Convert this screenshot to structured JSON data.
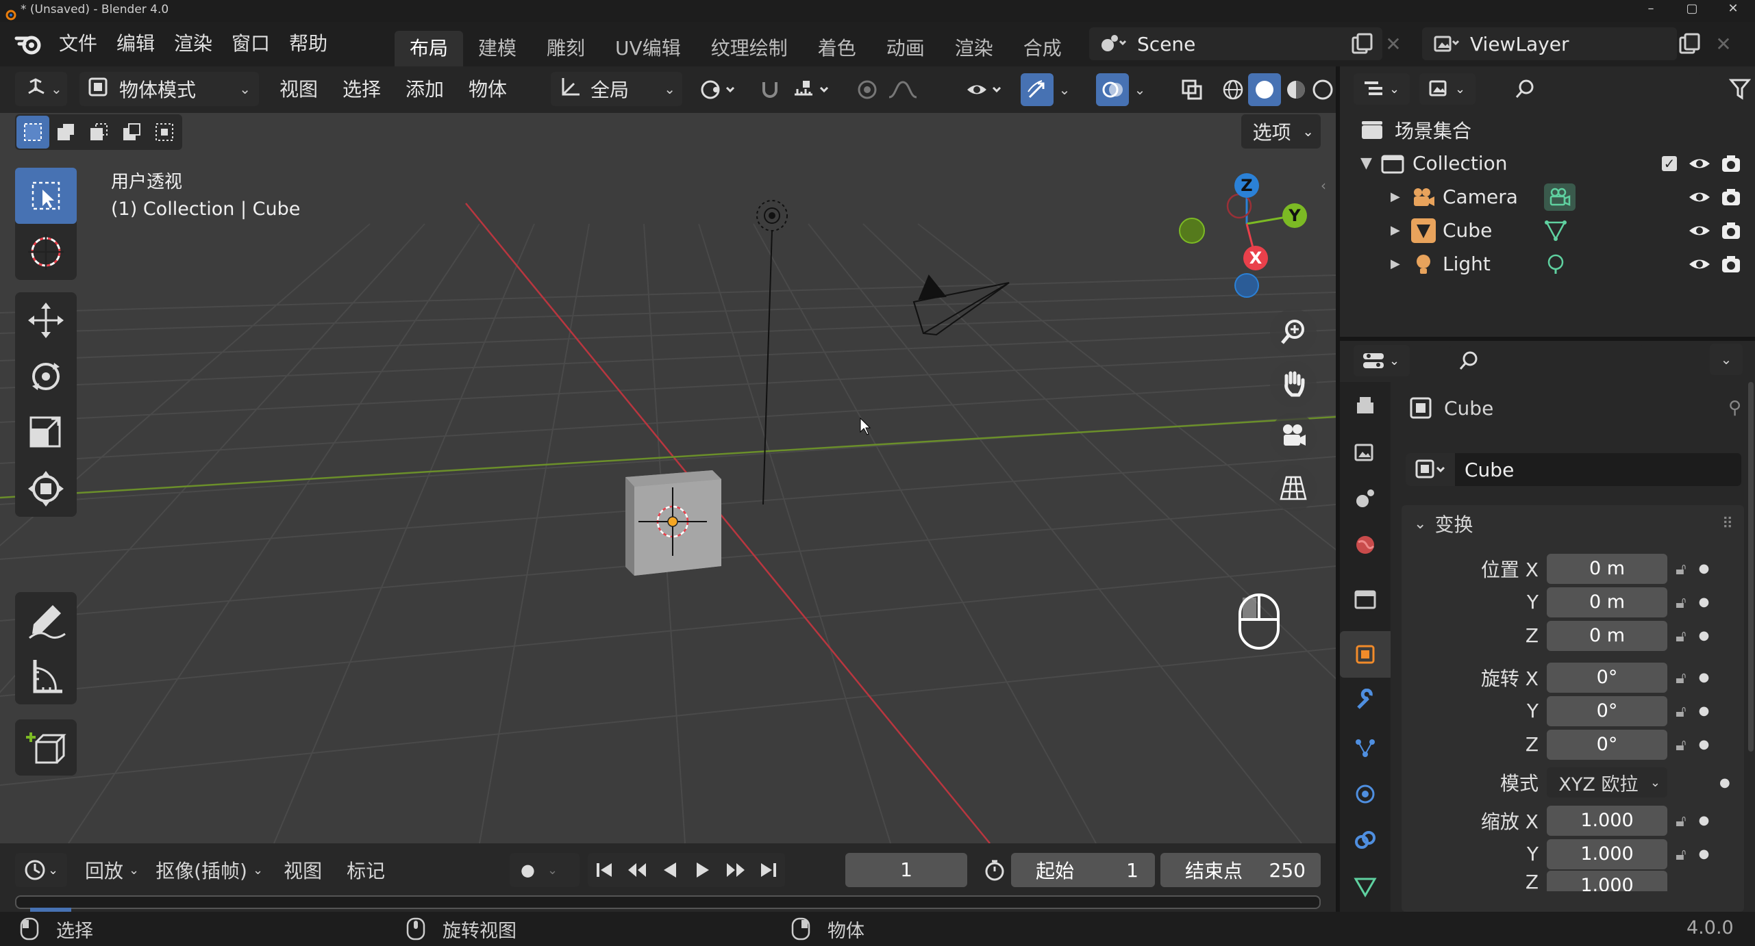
{
  "window": {
    "title": "* (Unsaved) - Blender 4.0",
    "controls": [
      "–",
      "▢",
      "✕"
    ]
  },
  "topbar": {
    "menus": [
      "文件",
      "编辑",
      "渲染",
      "窗口",
      "帮助"
    ],
    "workspaces": [
      "布局",
      "建模",
      "雕刻",
      "UV编辑",
      "纹理绘制",
      "着色",
      "动画",
      "渲染",
      "合成"
    ],
    "active_workspace": "布局",
    "scene_name": "Scene",
    "view_layer": "ViewLayer"
  },
  "viewport": {
    "mode": "物体模式",
    "menus": [
      "视图",
      "选择",
      "添加",
      "物体"
    ],
    "orientation": "全局",
    "options_label": "选项",
    "view_name": "用户透视",
    "context": "(1) Collection | Cube",
    "axes": {
      "x": "X",
      "y": "Y",
      "z": "Z"
    },
    "tools": [
      "select-box-tool",
      "cursor-tool",
      "move-tool",
      "rotate-tool",
      "scale-tool",
      "transform-tool",
      "annotate-tool",
      "measure-tool",
      "add-cube-tool"
    ],
    "colors": {
      "x_axis": "#e9404b",
      "y_axis": "#7cba24",
      "z_axis": "#2b81d7",
      "active_tool": "#4772b3",
      "selection": "#f5a623"
    }
  },
  "outliner": {
    "root": "场景集合",
    "collection": "Collection",
    "items": [
      {
        "name": "Camera",
        "type": "camera"
      },
      {
        "name": "Cube",
        "type": "mesh"
      },
      {
        "name": "Light",
        "type": "light"
      }
    ]
  },
  "properties": {
    "object_name": "Cube",
    "datablock_name": "Cube",
    "panel_title": "变换",
    "location": {
      "label": "位置 X",
      "y_label": "Y",
      "z_label": "Z",
      "x": "0 m",
      "y": "0 m",
      "z": "0 m"
    },
    "rotation": {
      "label": "旋转 X",
      "y_label": "Y",
      "z_label": "Z",
      "x": "0°",
      "y": "0°",
      "z": "0°"
    },
    "mode": {
      "label": "模式",
      "value": "XYZ 欧拉"
    },
    "scale": {
      "label": "缩放 X",
      "y_label": "Y",
      "z_label": "Z",
      "x": "1.000",
      "y": "1.000",
      "z": "1.000"
    }
  },
  "timeline": {
    "menus": [
      "回放",
      "抠像(插帧)",
      "视图",
      "标记"
    ],
    "current_frame": "1",
    "start_label": "起始",
    "start": "1",
    "end_label": "结束点",
    "end": "250"
  },
  "statusbar": {
    "select": "选择",
    "rotate_view": "旋转视图",
    "object": "物体",
    "version": "4.0.0"
  }
}
